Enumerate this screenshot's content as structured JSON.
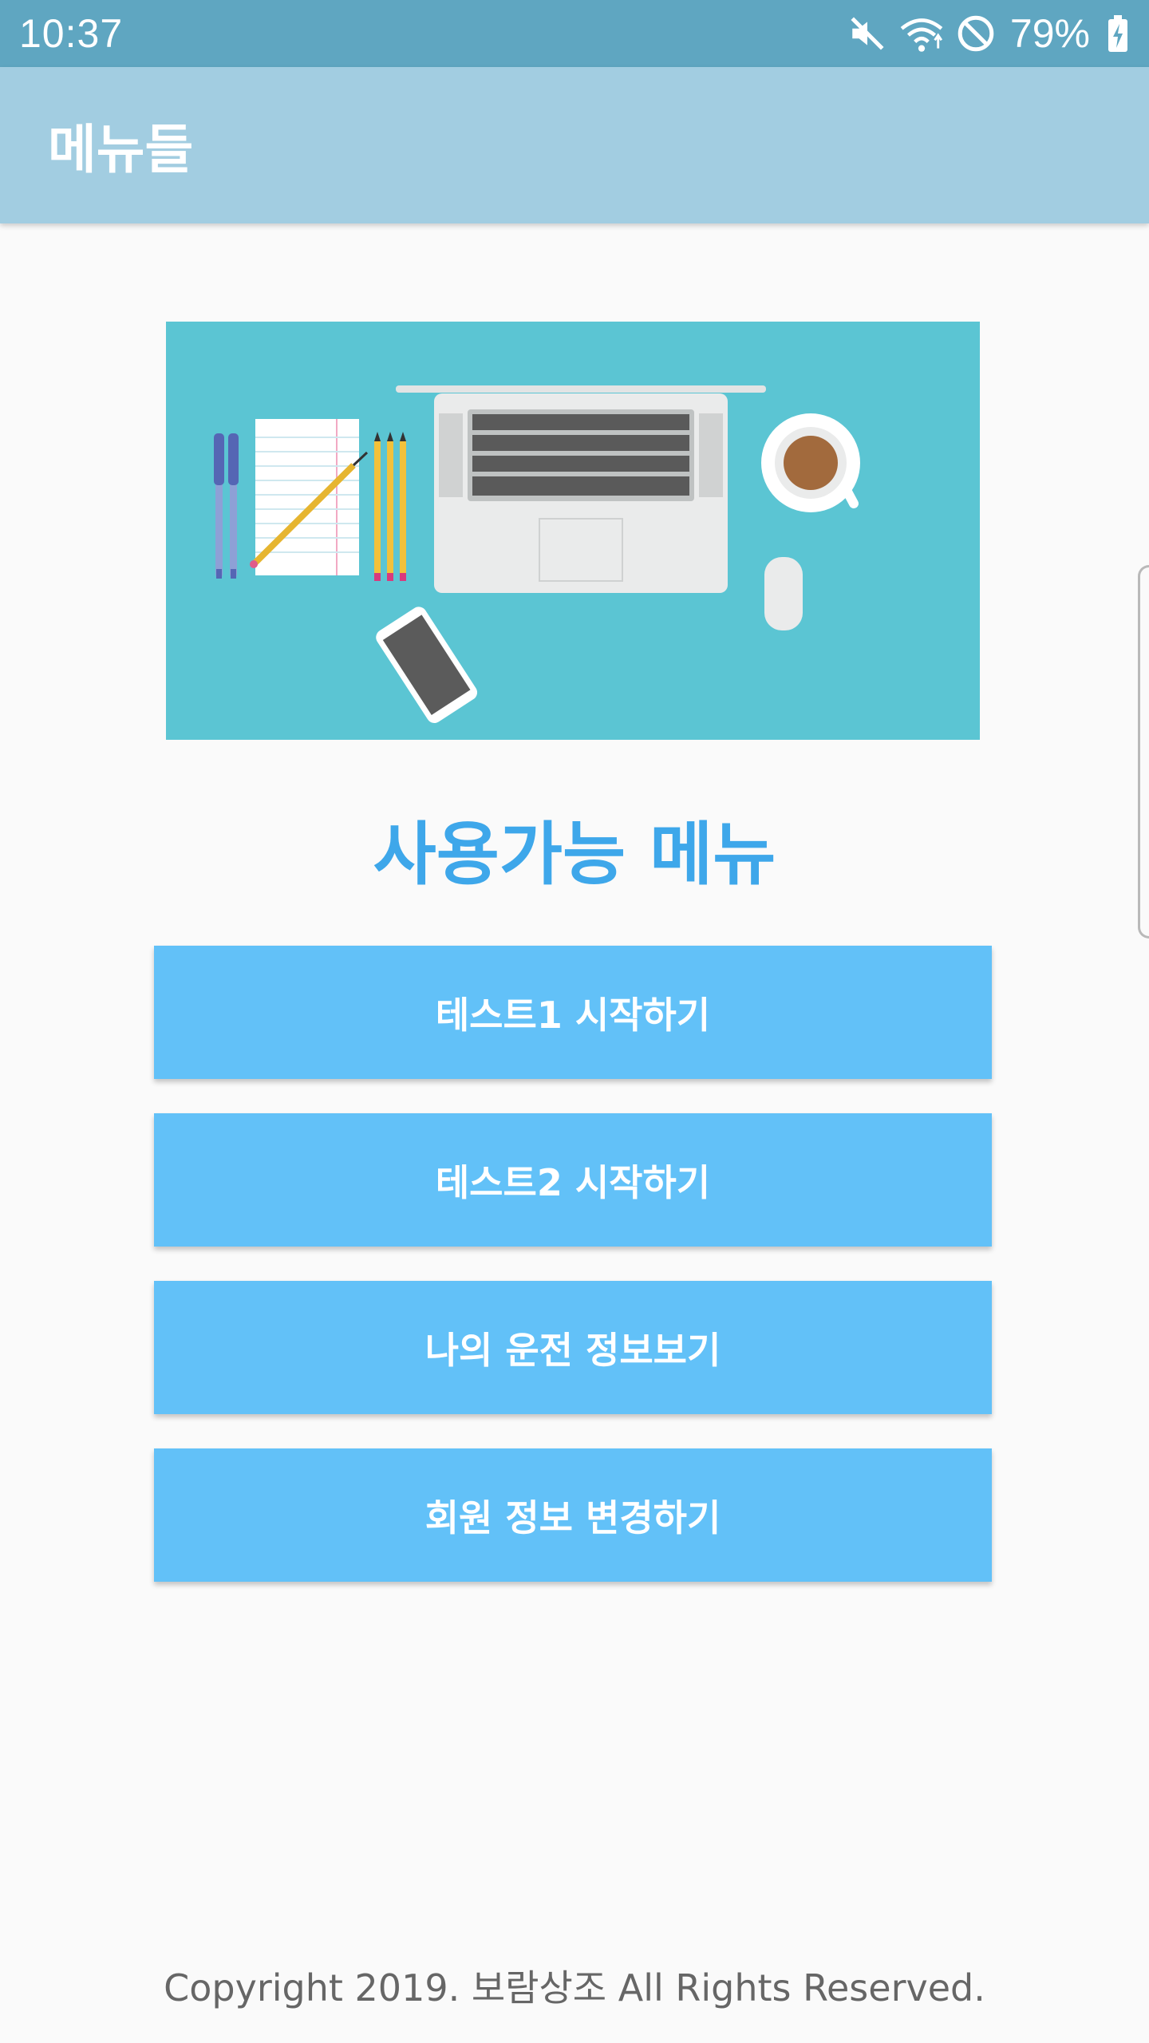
{
  "status_bar": {
    "time": "10:37",
    "battery_percent": "79%",
    "icons": [
      "mute-icon",
      "wifi-icon",
      "do-not-disturb-icon",
      "battery-charging-icon"
    ]
  },
  "app_bar": {
    "title": "메뉴들",
    "background": "#a2cde1"
  },
  "hero": {
    "image": "desk-illustration",
    "background": "#5bc5d3"
  },
  "section": {
    "title": "사용가능 메뉴",
    "color": "#3ea7ea"
  },
  "menu": {
    "button_color": "#62c1f8",
    "buttons": [
      {
        "label": "테스트1 시작하기"
      },
      {
        "label": "테스트2 시작하기"
      },
      {
        "label": "나의 운전 정보보기"
      },
      {
        "label": "회원 정보 변경하기"
      }
    ]
  },
  "footer": {
    "copyright": "Copyright 2019. 보람상조 All Rights Reserved."
  }
}
